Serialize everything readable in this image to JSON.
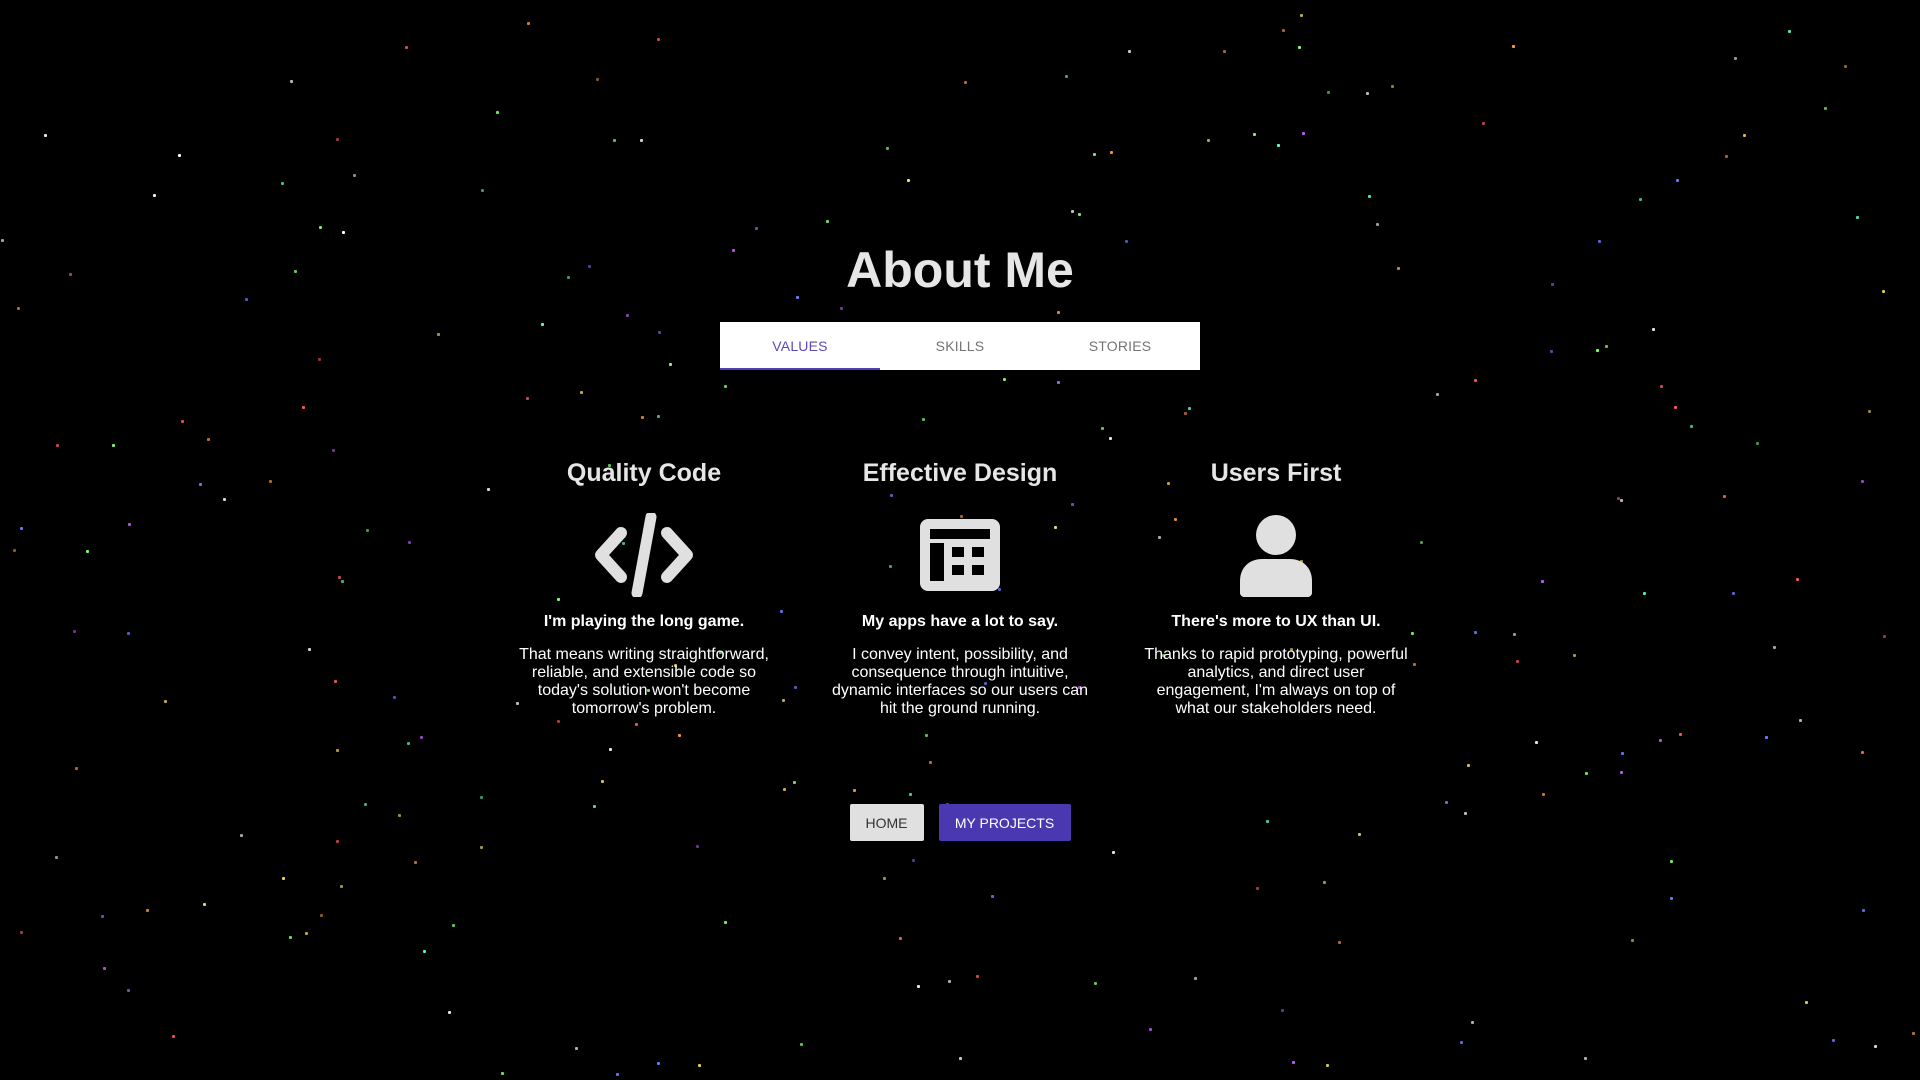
{
  "page": {
    "title": "About Me"
  },
  "tabs": [
    {
      "label": "VALUES",
      "active": true
    },
    {
      "label": "SKILLS",
      "active": false
    },
    {
      "label": "STORIES",
      "active": false
    }
  ],
  "cards": [
    {
      "title": "Quality Code",
      "icon": "code-icon",
      "tagline": "I'm playing the long game.",
      "description": "That means writing straightforward, reliable, and extensible code so today's solution won't become tomorrow's problem."
    },
    {
      "title": "Effective Design",
      "icon": "layout-icon",
      "tagline": "My apps have a lot to say.",
      "description": "I convey intent, possibility, and consequence through intuitive, dynamic interfaces so our users can hit the ground running."
    },
    {
      "title": "Users First",
      "icon": "user-icon",
      "tagline": "There's more to UX than UI.",
      "description": "Thanks to rapid prototyping, powerful analytics, and direct user engagement, I'm always on top of what our stakeholders need."
    }
  ],
  "buttons": {
    "home_label": "HOME",
    "projects_label": "MY PROJECTS"
  },
  "colors": {
    "background": "#000000",
    "accent": "#4a38b0",
    "text": "#e6e6e6",
    "tab_active": "#5a4bb5",
    "star_palette": [
      "#7fff6a",
      "#ff5a5a",
      "#6a7aff",
      "#ffffff",
      "#ffe45a",
      "#c45aff",
      "#ff9a3a",
      "#5affd6"
    ]
  }
}
